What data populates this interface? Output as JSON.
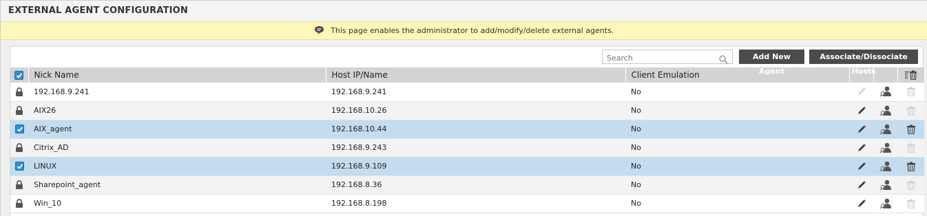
{
  "title": "EXTERNAL AGENT CONFIGURATION",
  "info": "This page enables the administrator to add/modify/delete external agents.",
  "toolbar": {
    "search_placeholder": "Search",
    "add_label": "Add New Agent",
    "assoc_label": "Associate/Dissociate Hosts"
  },
  "columns": {
    "nick": "Nick Name",
    "host": "Host IP/Name",
    "emulation": "Client Emulation"
  },
  "rows": [
    {
      "nick": "192.168.9.241",
      "host": "192.168.9.241",
      "emulation": "No",
      "selected": false,
      "editable": false,
      "deletable": false
    },
    {
      "nick": "AIX26",
      "host": "192.168.10.26",
      "emulation": "No",
      "selected": false,
      "editable": true,
      "deletable": false
    },
    {
      "nick": "AIX_agent",
      "host": "192.168.10.44",
      "emulation": "No",
      "selected": true,
      "editable": true,
      "deletable": true
    },
    {
      "nick": "Citrix_AD",
      "host": "192.168.9.243",
      "emulation": "No",
      "selected": false,
      "editable": true,
      "deletable": false
    },
    {
      "nick": "LINUX",
      "host": "192.168.9.109",
      "emulation": "No",
      "selected": true,
      "editable": true,
      "deletable": true
    },
    {
      "nick": "Sharepoint_agent",
      "host": "192.168.8.36",
      "emulation": "No",
      "selected": false,
      "editable": true,
      "deletable": false
    },
    {
      "nick": "Win_10",
      "host": "192.168.8.198",
      "emulation": "No",
      "selected": false,
      "editable": true,
      "deletable": false
    }
  ],
  "colors": {
    "accent": "#2e8fd0",
    "selected_row": "#c3dcef",
    "info_bar": "#fdf8b8",
    "button": "#4b4b4b"
  }
}
